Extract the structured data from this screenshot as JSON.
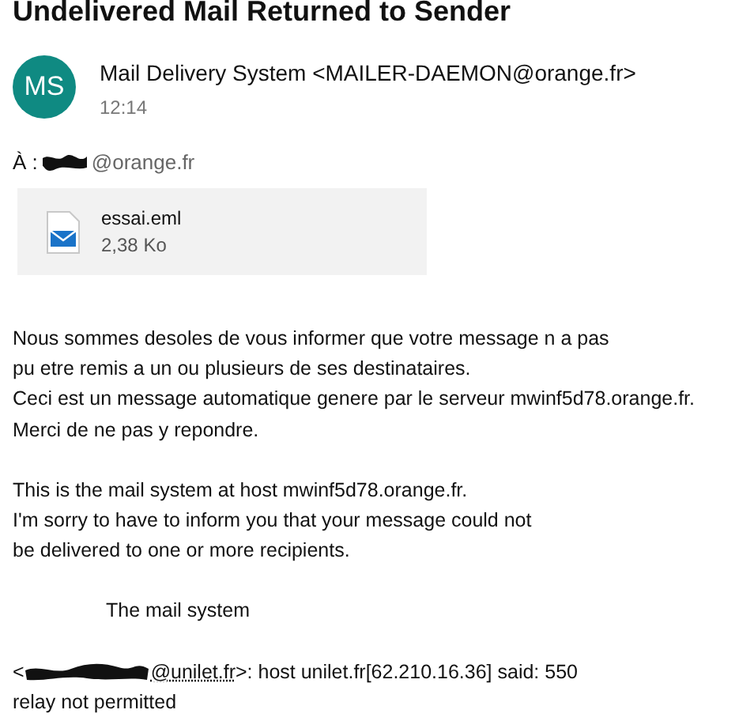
{
  "subject": "Undelivered Mail Returned to Sender",
  "sender": {
    "initials": "MS",
    "name": "Mail Delivery System <MAILER-DAEMON@orange.fr>",
    "time": "12:14"
  },
  "to": {
    "label": "À :",
    "domain": "@orange.fr"
  },
  "attachment": {
    "name": "essai.eml",
    "size": "2,38 Ko"
  },
  "paragraphs": [
    {
      "kind": "text",
      "lines": [
        "Nous sommes desoles de vous informer que votre message n a pas",
        "pu etre remis a un ou plusieurs de ses destinataires.",
        "Ceci est un message automatique genere par le serveur mwinf5d78.orange.fr.",
        "Merci de ne pas y repondre."
      ]
    },
    {
      "kind": "text",
      "lines": [
        "This is the mail system at host mwinf5d78.orange.fr.",
        "I'm sorry to have to inform you that your message could not",
        "be delivered to one or more recipients."
      ]
    },
    {
      "kind": "indented",
      "lines": [
        "The mail system"
      ]
    }
  ],
  "error": {
    "open": "<",
    "link": "@unilet.fr",
    "rest": ">: host unilet.fr[62.210.16.36] said: 550",
    "line2": "relay not permitted"
  }
}
